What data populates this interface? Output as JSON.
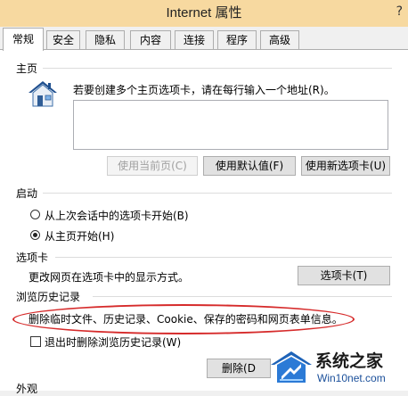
{
  "window": {
    "title": "Internet 属性",
    "help": "?"
  },
  "tabs": [
    {
      "label": "常规",
      "active": true
    },
    {
      "label": "安全"
    },
    {
      "label": "隐私"
    },
    {
      "label": "内容"
    },
    {
      "label": "连接"
    },
    {
      "label": "程序"
    },
    {
      "label": "高级"
    }
  ],
  "homepage": {
    "section_label": "主页",
    "instruction": "若要创建多个主页选项卡，请在每行输入一个地址(R)。",
    "value": "",
    "buttons": {
      "use_current": "使用当前页(C)",
      "use_default": "使用默认值(F)",
      "use_new_tab": "使用新选项卡(U)"
    },
    "icon": "house-icon"
  },
  "startup": {
    "section_label": "启动",
    "options": [
      {
        "label": "从上次会话中的选项卡开始(B)",
        "checked": false
      },
      {
        "label": "从主页开始(H)",
        "checked": true
      }
    ]
  },
  "tabs_section": {
    "section_label": "选项卡",
    "description": "更改网页在选项卡中的显示方式。",
    "button": "选项卡(T)"
  },
  "history": {
    "section_label": "浏览历史记录",
    "description": "删除临时文件、历史记录、Cookie、保存的密码和网页表单信息。",
    "checkbox_label": "退出时删除浏览历史记录(W)",
    "checkbox_checked": false,
    "delete_button": "删除(D"
  },
  "appearance": {
    "section_label": "外观"
  },
  "watermark": {
    "line1": "系统之家",
    "line2": "Win10net.com"
  },
  "colors": {
    "highlight_ellipse": "#d62b2b",
    "titlebar": "#f7d9a0"
  }
}
